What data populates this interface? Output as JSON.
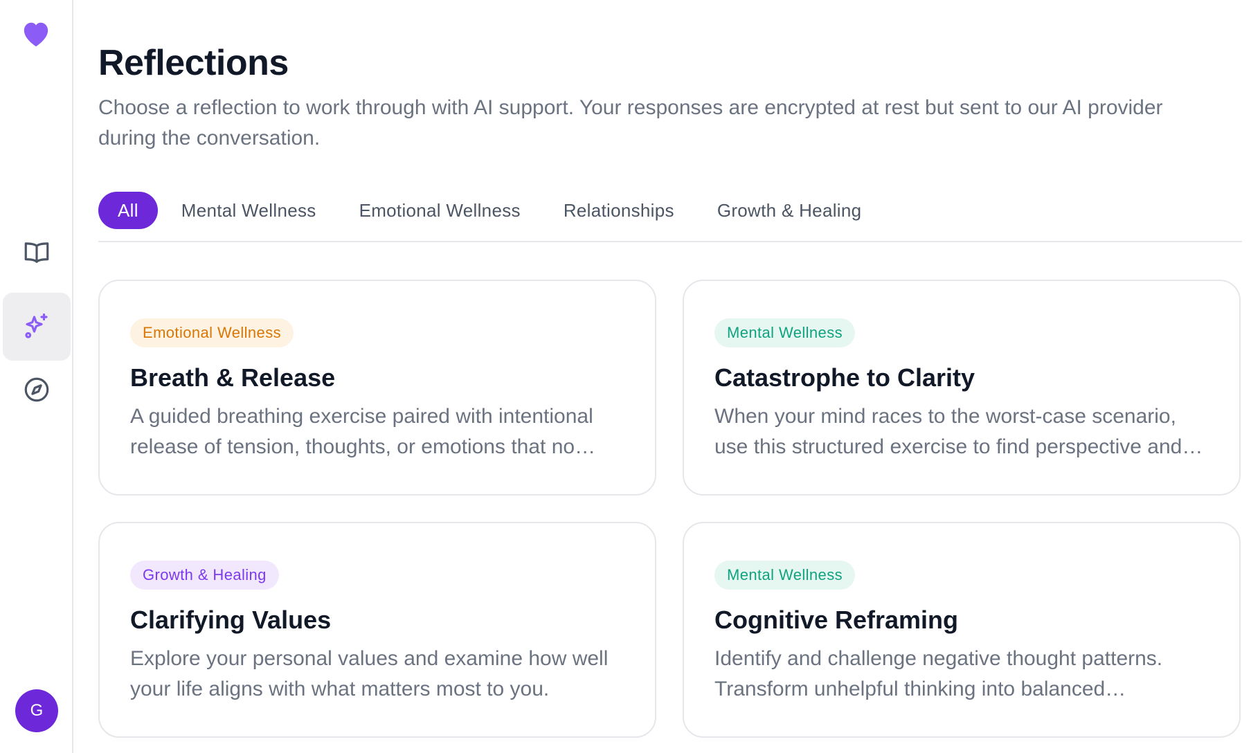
{
  "app": {
    "accent": "#6d28d9",
    "logo_color": "#8b5cf6"
  },
  "sidebar": {
    "logo_icon": "heart-icon",
    "items": [
      {
        "icon": "book-open-icon",
        "active": false
      },
      {
        "icon": "sparkles-icon",
        "active": true
      },
      {
        "icon": "compass-icon",
        "active": false
      }
    ],
    "avatar_initial": "G"
  },
  "header": {
    "title": "Reflections",
    "subtitle": "Choose a reflection to work through with AI support. Your responses are encrypted at rest but sent to our AI provider during the conversation."
  },
  "tabs": [
    {
      "label": "All",
      "active": true
    },
    {
      "label": "Mental Wellness",
      "active": false
    },
    {
      "label": "Emotional Wellness",
      "active": false
    },
    {
      "label": "Relationships",
      "active": false
    },
    {
      "label": "Growth & Healing",
      "active": false
    }
  ],
  "cards": [
    {
      "category": "Emotional Wellness",
      "title": "Breath & Release",
      "description": "A guided breathing exercise paired with intentional release of tension, thoughts, or emotions that no longer serve you."
    },
    {
      "category": "Mental Wellness",
      "title": "Catastrophe to Clarity",
      "description": "When your mind races to the worst-case scenario, use this structured exercise to find perspective and calm."
    },
    {
      "category": "Growth & Healing",
      "title": "Clarifying Values",
      "description": "Explore your personal values and examine how well your life aligns with what matters most to you."
    },
    {
      "category": "Mental Wellness",
      "title": "Cognitive Reframing",
      "description": "Identify and challenge negative thought patterns. Transform unhelpful thinking into balanced perspectives."
    }
  ]
}
